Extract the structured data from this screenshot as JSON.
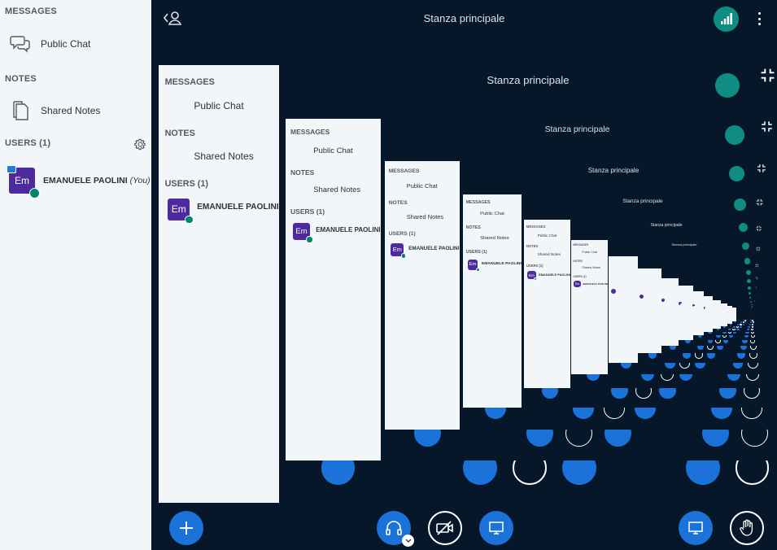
{
  "sidebar": {
    "messages_label": "MESSAGES",
    "public_chat": "Public Chat",
    "notes_label": "NOTES",
    "shared_notes": "Shared Notes",
    "users_label": "USERS (1)",
    "user": {
      "initials": "Em",
      "name": "EMANUELE PAOLINI",
      "you": "(You)"
    }
  },
  "header": {
    "title": "Stanza principale"
  },
  "icons": {
    "back": "user-back-icon",
    "signal": "connection-signal-icon",
    "menu": "kebab-menu-icon",
    "chat": "chat-bubbles-icon",
    "notes": "notes-icon",
    "settings": "gear-icon",
    "add": "plus-icon",
    "audio": "headphones-icon",
    "video": "video-off-icon",
    "screen": "screen-share-icon",
    "raise_hand": "raise-hand-icon",
    "exit_fullscreen": "exit-fullscreen-icon"
  },
  "colors": {
    "sidebar_bg": "#F3F6F9",
    "main_bg": "#06172A",
    "accent_blue": "#1B73DA",
    "signal_green": "#0F8C83",
    "avatar_purple": "#4D2A9E"
  }
}
